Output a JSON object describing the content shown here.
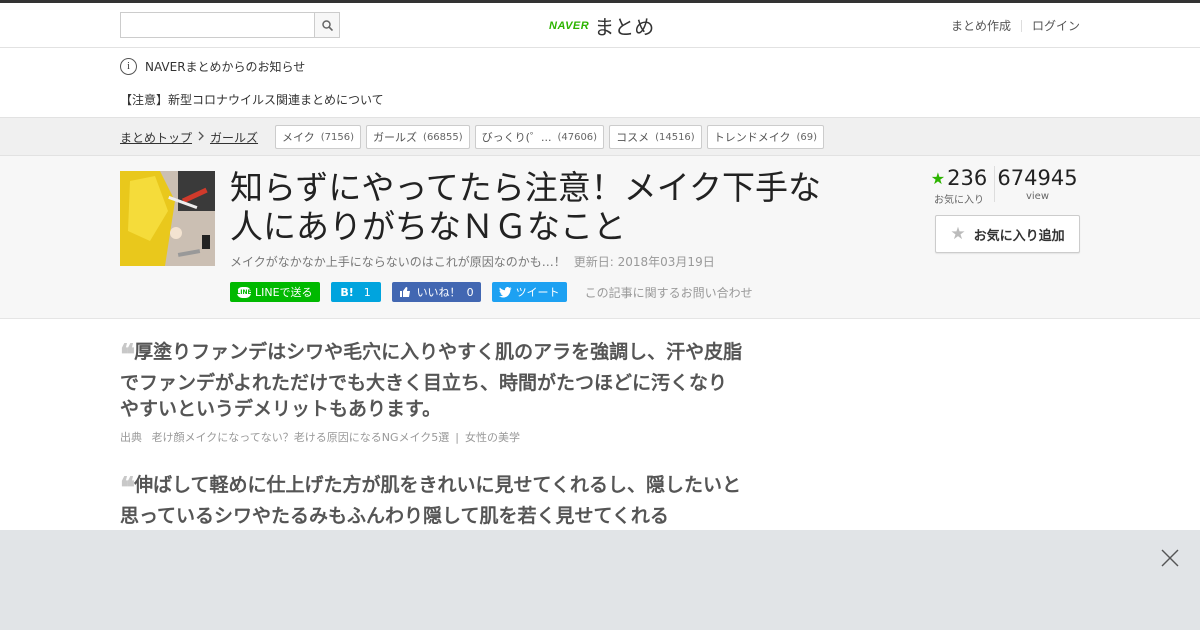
{
  "header": {
    "search_placeholder": "",
    "logo_brand": "NAVER",
    "logo_name": "まとめ",
    "links": [
      "まとめ作成",
      "ログイン"
    ]
  },
  "notice": {
    "heading": "NAVERまとめからのお知らせ",
    "item": "【注意】新型コロナウイルス関連まとめについて"
  },
  "breadcrumb": {
    "items": [
      "まとめトップ",
      "ガールズ"
    ]
  },
  "tags": [
    {
      "label": "メイク",
      "count": "(7156)"
    },
    {
      "label": "ガールズ",
      "count": "(66855)"
    },
    {
      "label": "びっくり(゜...",
      "count": "(47606)"
    },
    {
      "label": "コスメ",
      "count": "(14516)"
    },
    {
      "label": "トレンドメイク",
      "count": "(69)"
    }
  ],
  "article": {
    "title": "知らずにやってたら注意！メイク下手な人にありがちなＮＧなこと",
    "description": "メイクがなかなか上手にならないのはこれが原因なのかも…！",
    "updated": "更新日: 2018年03月19日",
    "share": {
      "line": "LINEで送る",
      "hatena_label": "B!",
      "hatena_count": "1",
      "fb_label": "いいね！",
      "fb_count": "0",
      "tweet": "ツイート"
    },
    "contact": "この記事に関するお問い合わせ"
  },
  "stats": {
    "favorites": "236",
    "favorites_label": "お気に入り",
    "views": "674945",
    "views_label": "view",
    "fav_button": "お気に入り追加"
  },
  "quotes": [
    {
      "text": "厚塗りファンデはシワや毛穴に入りやすく肌のアラを強調し、汗や皮脂でファンデがよれただけでも大きく目立ち、時間がたつほどに汚くなりやすいというデメリットもあります。",
      "source_prefix": "出典",
      "source_title": "老け顔メイクになってない？老ける原因になるNGメイク5選",
      "source_site": "女性の美学"
    },
    {
      "text": "伸ばして軽めに仕上げた方が肌をきれいに見せてくれるし、隠したいと思っているシワやたるみもふんわり隠して肌を若く見せてくれる"
    }
  ],
  "colors": {
    "naver_green": "#2db400",
    "line_green": "#00b900",
    "hatena_blue": "#00a4de",
    "facebook_blue": "#4267b2",
    "twitter_blue": "#1da1f2"
  }
}
